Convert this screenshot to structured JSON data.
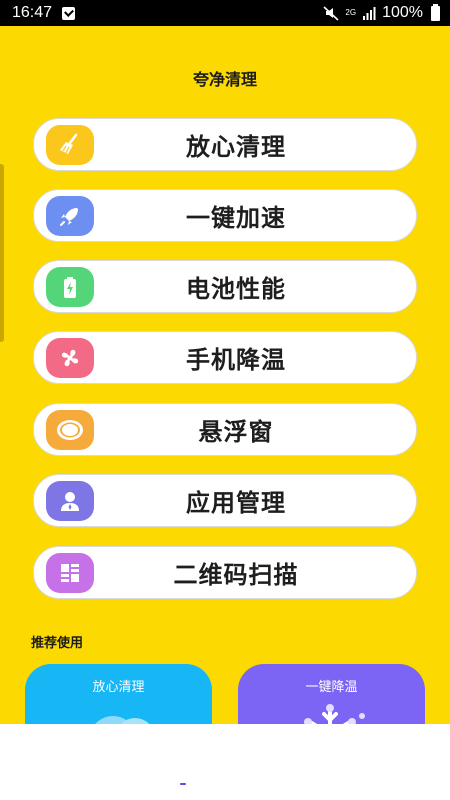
{
  "status_bar": {
    "time": "16:47",
    "network": "2G",
    "battery": "100%"
  },
  "app": {
    "title": "夸净清理",
    "background": "#fcd900"
  },
  "menu": [
    {
      "label": "放心清理",
      "icon": "broom-icon",
      "color": "#fcc71d"
    },
    {
      "label": "一键加速",
      "icon": "rocket-icon",
      "color": "#6d8ff2"
    },
    {
      "label": "电池性能",
      "icon": "battery-charging-icon",
      "color": "#54d57a"
    },
    {
      "label": "手机降温",
      "icon": "fan-icon",
      "color": "#f36a87"
    },
    {
      "label": "悬浮窗",
      "icon": "floating-window-icon",
      "color": "#f6aa3a"
    },
    {
      "label": "应用管理",
      "icon": "user-manage-icon",
      "color": "#7f76e6"
    },
    {
      "label": "二维码扫描",
      "icon": "qr-scan-icon",
      "color": "#c671e8"
    }
  ],
  "recommend": {
    "label": "推荐使用",
    "cards": [
      {
        "title": "放心清理",
        "icon": "cloud-icon",
        "color": "#17b6f5"
      },
      {
        "title": "一键降温",
        "icon": "snowflake-icon",
        "color": "#7c64f5"
      }
    ]
  }
}
